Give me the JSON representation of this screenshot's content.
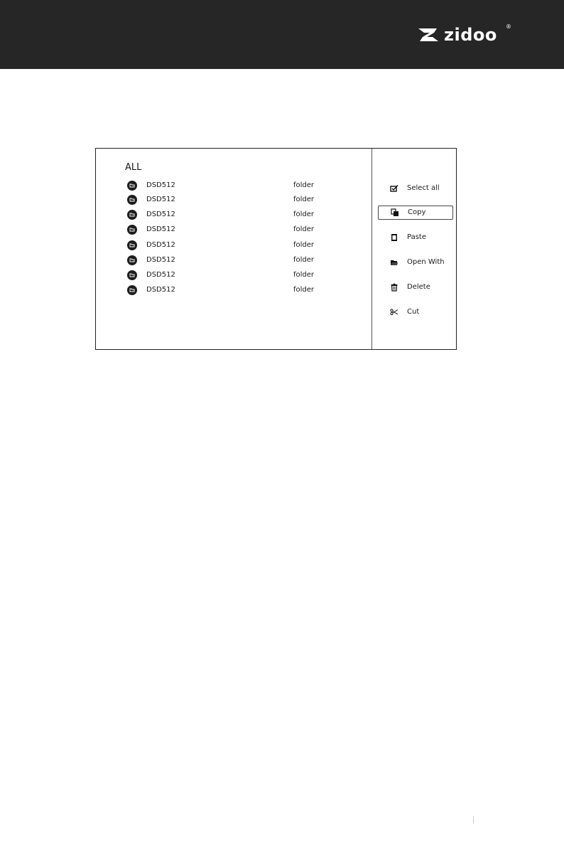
{
  "brand": {
    "name": "zidoo",
    "registered": "®"
  },
  "file_list": {
    "title": "ALL",
    "items": [
      {
        "name": "DSD512",
        "type": "folder"
      },
      {
        "name": "DSD512",
        "type": "folder"
      },
      {
        "name": "DSD512",
        "type": "folder"
      },
      {
        "name": "DSD512",
        "type": "folder"
      },
      {
        "name": "DSD512",
        "type": "folder"
      },
      {
        "name": "DSD512",
        "type": "folder"
      },
      {
        "name": "DSD512",
        "type": "folder"
      },
      {
        "name": "DSD512",
        "type": "folder"
      }
    ]
  },
  "context_menu": {
    "items": [
      {
        "label": "Select all",
        "icon": "checkbox-icon",
        "selected": false
      },
      {
        "label": "Copy",
        "icon": "copy-icon",
        "selected": true
      },
      {
        "label": "Paste",
        "icon": "paste-icon",
        "selected": false
      },
      {
        "label": "Open With",
        "icon": "open-with-icon",
        "selected": false
      },
      {
        "label": "Delete",
        "icon": "trash-icon",
        "selected": false
      },
      {
        "label": "Cut",
        "icon": "scissors-icon",
        "selected": false
      }
    ]
  },
  "colors": {
    "header": "#262626",
    "border": "#222222"
  }
}
